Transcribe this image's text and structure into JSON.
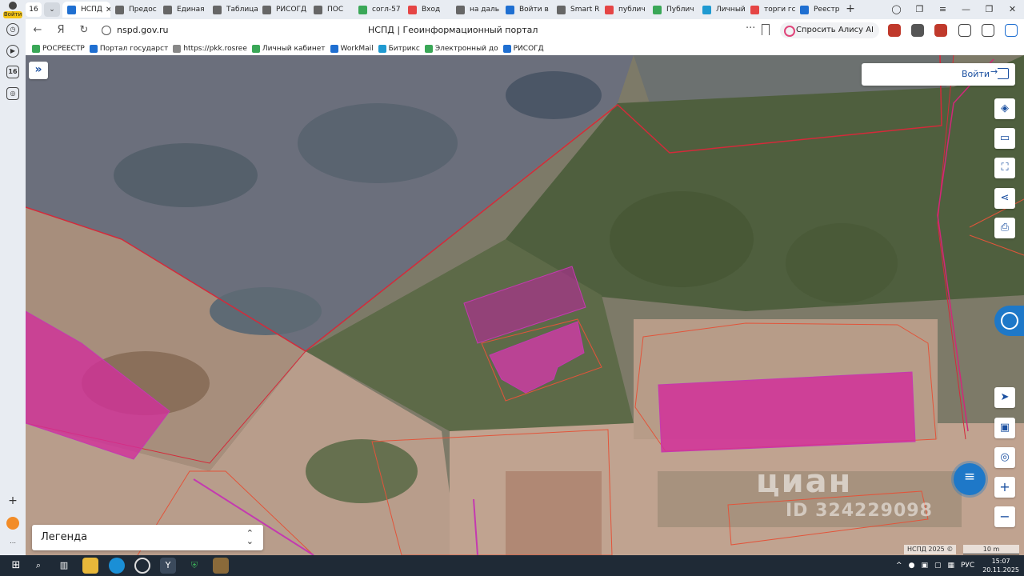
{
  "browser": {
    "profile_label": "Войти",
    "tab_count": "16",
    "tabs": [
      {
        "label": "НСПД",
        "active": true,
        "fav_color": "#1f6fd1"
      },
      {
        "label": "Предос",
        "fav_color": "#666"
      },
      {
        "label": "Единая",
        "fav_color": "#666"
      },
      {
        "label": "Таблица",
        "fav_color": "#666"
      },
      {
        "label": "РИСОГД",
        "fav_color": "#666"
      },
      {
        "label": "ПОС",
        "fav_color": "#666"
      },
      {
        "label": "согл-57",
        "fav_color": "#3aa757"
      },
      {
        "label": "Вход",
        "fav_color": "#e54545"
      },
      {
        "label": "на даль",
        "fav_color": "#666"
      },
      {
        "label": "Войти в",
        "fav_color": "#1f6fd1"
      },
      {
        "label": "Smart R",
        "fav_color": "#666"
      },
      {
        "label": "публич",
        "fav_color": "#e54545"
      },
      {
        "label": "Публич",
        "fav_color": "#3aa757"
      },
      {
        "label": "Личный",
        "fav_color": "#1f9ad1"
      },
      {
        "label": "торги гс",
        "fav_color": "#e54545"
      },
      {
        "label": "Реестр",
        "fav_color": "#1f6fd1"
      }
    ],
    "url": "nspd.gov.ru",
    "page_title": "НСПД | Геоинформационный портал",
    "alisa_label": "Спросить Алису AI",
    "bookmarks": [
      {
        "label": "РОСРЕЕСТР",
        "color": "#3aa757"
      },
      {
        "label": "Портал государст",
        "color": "#1f6fd1"
      },
      {
        "label": "https://pkk.rosree",
        "color": "#888"
      },
      {
        "label": "Личный кабинет",
        "color": "#3aa757"
      },
      {
        "label": "WorkMail",
        "color": "#1f6fd1"
      },
      {
        "label": "Битрикс",
        "color": "#1f9ad1"
      },
      {
        "label": "Электронный до",
        "color": "#3aa757"
      },
      {
        "label": "РИСОГД",
        "color": "#1f6fd1"
      }
    ],
    "sidebar_badge": "16"
  },
  "map": {
    "login_label": "Войти",
    "legend_label": "Легенда",
    "watermark": "циан",
    "watermark_id": "ID 324229098",
    "attribution": "НСПД 2025 ©",
    "scale_label": "10 m"
  },
  "taskbar": {
    "lang": "РУС",
    "time": "15:07",
    "date": "20.11.2025"
  }
}
